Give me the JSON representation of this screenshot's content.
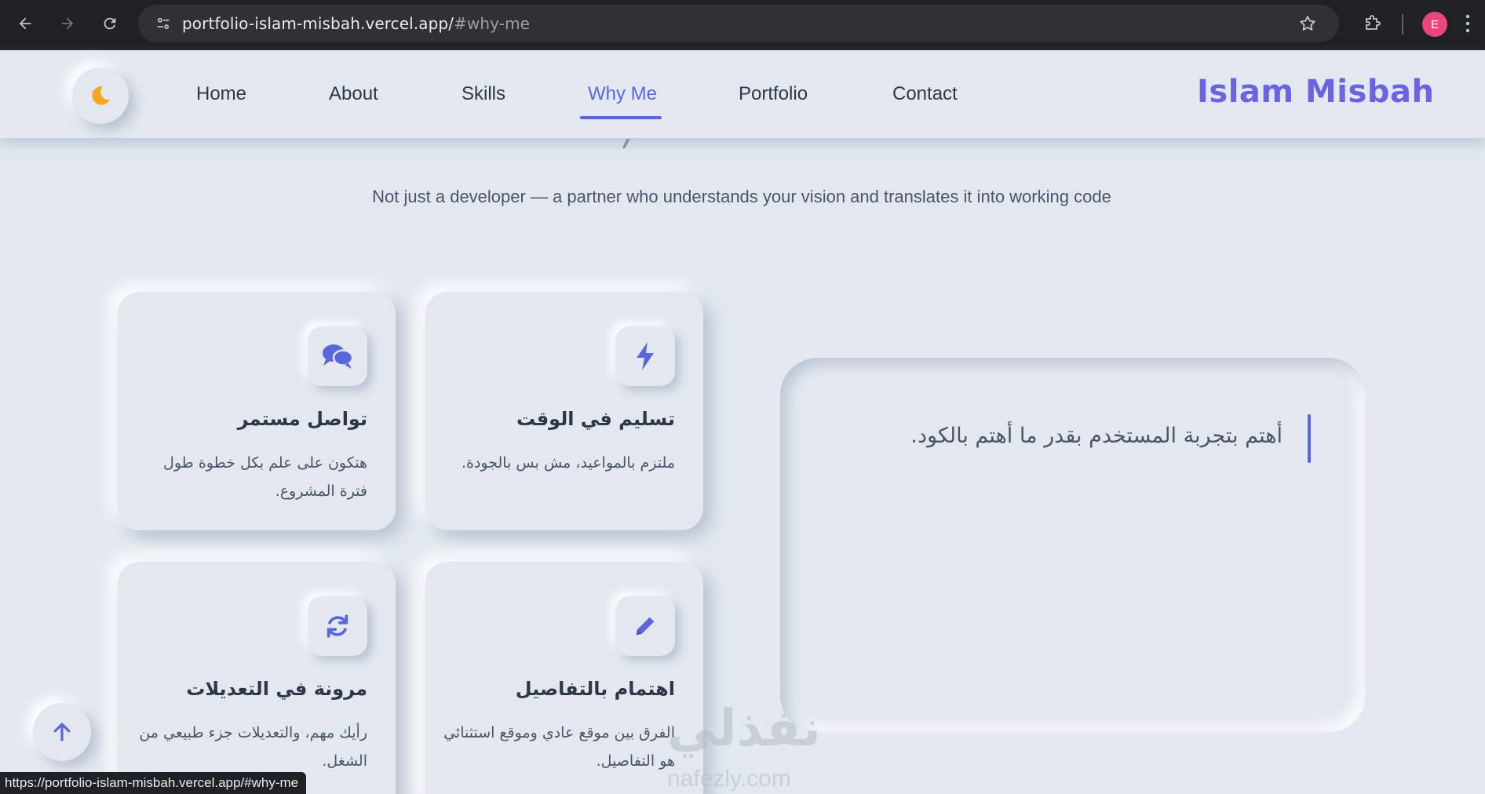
{
  "browser": {
    "url_main": "portfolio-islam-misbah.vercel.app/",
    "url_hash": "#why-me",
    "profile_initial": "E",
    "status_link": "https://portfolio-islam-misbah.vercel.app/#why-me"
  },
  "nav": {
    "links": [
      "Home",
      "About",
      "Skills",
      "Why Me",
      "Portfolio",
      "Contact"
    ],
    "active": "Why Me",
    "brand": "Islam Misbah",
    "accent_color": "#5a67d8",
    "theme_icon": "moon-icon"
  },
  "section": {
    "subtitle": "Not just a developer — a partner who understands your vision and translates it into working code"
  },
  "cards": [
    {
      "icon": "chat-bubbles-icon",
      "title": "تواصل مستمر",
      "desc": "هتكون على علم بكل خطوة طول فترة المشروع."
    },
    {
      "icon": "lightning-icon",
      "title": "تسليم في الوقت",
      "desc": "ملتزم بالمواعيد، مش بس بالجودة."
    },
    {
      "icon": "refresh-icon",
      "title": "مرونة في التعديلات",
      "desc": "رأيك مهم، والتعديلات جزء طبيعي من الشغل."
    },
    {
      "icon": "pen-icon",
      "title": "اهتمام بالتفاصيل",
      "desc": "الفرق بين موقع عادي وموقع استثنائي هو التفاصيل."
    }
  ],
  "quote": {
    "text": "أهتم بتجربة المستخدم بقدر ما أهتم بالكود."
  },
  "watermark": {
    "arabic": "نفذلي",
    "latin": "nafezly.com"
  }
}
